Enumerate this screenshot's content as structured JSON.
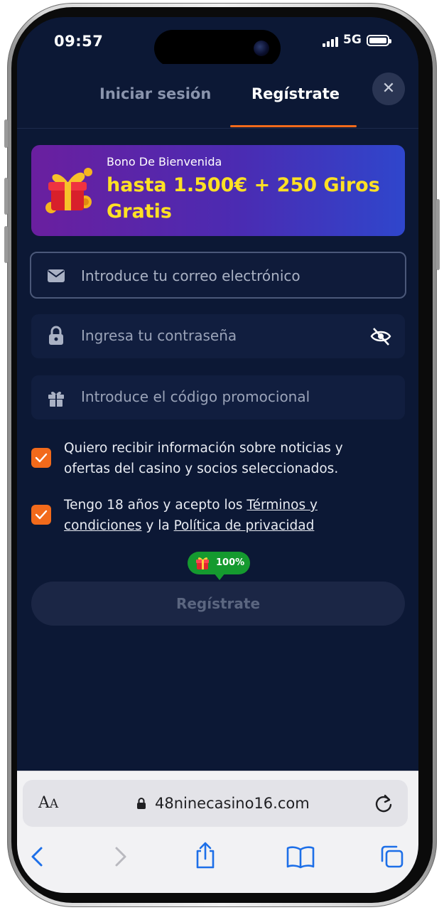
{
  "status_bar": {
    "time": "09:57",
    "network": "5G"
  },
  "tabs": {
    "login": "Iniciar sesión",
    "register": "Regístrate",
    "close": "✕"
  },
  "banner": {
    "title": "Bono De Bienvenida",
    "offer": "hasta 1.500€ + 250 Giros Gratis"
  },
  "form": {
    "email_placeholder": "Introduce tu correo electrónico",
    "password_placeholder": "Ingresa tu contraseña",
    "promo_placeholder": "Introduce el código promocional"
  },
  "consents": {
    "news": {
      "checked": true,
      "text": "Quiero recibir información sobre noticias y ofertas del casino y socios seleccionados."
    },
    "terms": {
      "checked": true,
      "prefix": "Tengo 18 años y acepto los ",
      "terms_link": "Términos y condiciones",
      "middle": " y la ",
      "privacy_link": "Política de privacidad"
    }
  },
  "progress": {
    "label": "100%",
    "value": 100
  },
  "submit": {
    "label": "Regístrate"
  },
  "browser": {
    "url": "48ninecasino16.com",
    "text_size_label_big": "A",
    "text_size_label_small": "A"
  },
  "colors": {
    "accent": "#f26a1b",
    "background": "#0c1835",
    "offer": "#ffe124",
    "progress": "#159a2f"
  },
  "icons": [
    "envelope-icon",
    "lock-icon",
    "eye-off-icon",
    "gift-icon",
    "check-icon",
    "back-icon",
    "forward-icon",
    "share-icon",
    "bookmarks-icon",
    "tabs-icon",
    "reload-icon"
  ]
}
